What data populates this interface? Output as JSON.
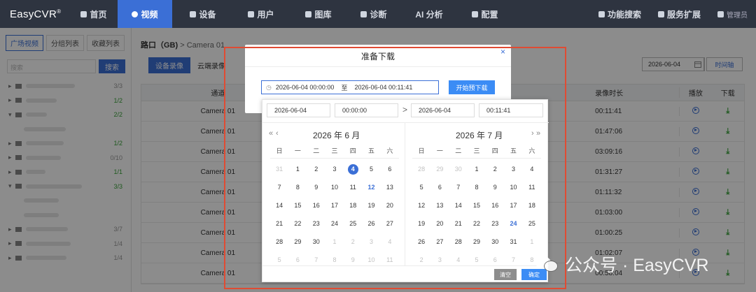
{
  "app": {
    "logo": "EasyCVR",
    "logo_mark": "®"
  },
  "nav": {
    "items": [
      {
        "label": "首页",
        "icon": "home-icon"
      },
      {
        "label": "视频",
        "icon": "video-play-icon",
        "active": true
      },
      {
        "label": "设备",
        "icon": "device-icon"
      },
      {
        "label": "用户",
        "icon": "user-icon"
      },
      {
        "label": "图库",
        "icon": "gallery-icon"
      },
      {
        "label": "诊断",
        "icon": "diagnosis-icon"
      },
      {
        "label": "AI 分析",
        "icon": ""
      },
      {
        "label": "配置",
        "icon": "gear-icon"
      }
    ],
    "right": [
      {
        "label": "功能搜索",
        "icon": "search-icon"
      },
      {
        "label": "服务扩展",
        "icon": "puzzle-icon"
      },
      {
        "label": "管理员",
        "icon": "user-icon"
      }
    ]
  },
  "sidebar": {
    "tabs": [
      "广场视频",
      "分组列表",
      "收藏列表"
    ],
    "search_placeholder": "搜索",
    "search_button": "搜索",
    "tree_counts": [
      "3/3",
      "1/2",
      "2/2",
      "",
      "1/2",
      "0/10",
      "1/1",
      "3/3",
      "",
      "",
      "3/7",
      "1/4",
      "1/4"
    ]
  },
  "content": {
    "breadcrumb_root": "路口（GB)",
    "breadcrumb_sep": ">",
    "breadcrumb_leaf": "Camera 01",
    "tabs": [
      "设备录像",
      "云端录像"
    ],
    "date": "2026-06-04",
    "timeline_button": "时间轴",
    "table": {
      "headers": {
        "channel": "通道",
        "duration": "录像时长",
        "play": "播放",
        "download": "下载"
      },
      "rows": [
        {
          "channel": "Camera 01",
          "duration": "00:11:41"
        },
        {
          "channel": "Camera 01",
          "duration": "01:47:06"
        },
        {
          "channel": "Camera 01",
          "duration": "03:09:16"
        },
        {
          "channel": "Camera 01",
          "duration": "01:31:27"
        },
        {
          "channel": "Camera 01",
          "duration": "01:11:32"
        },
        {
          "channel": "Camera 01",
          "duration": "01:03:00"
        },
        {
          "channel": "Camera 01",
          "duration": "01:00:25"
        },
        {
          "channel": "Camera 01",
          "duration": "01:02:07"
        },
        {
          "channel": "Camera 01",
          "duration": "00:58:04"
        }
      ]
    }
  },
  "dialog": {
    "title": "准备下载",
    "close": "×",
    "range_start": "2026-06-04 00:00:00",
    "range_sep": "至",
    "range_end": "2026-06-04 00:11:41",
    "prepare_button": "开始预下载"
  },
  "picker": {
    "start_date": "2026-06-04",
    "start_time": "00:00:00",
    "end_date": "2026-06-04",
    "end_time": "00:11:41",
    "left_title": "2026 年 6 月",
    "right_title": "2026 年 7 月",
    "prev_year": "«",
    "prev_month": "‹",
    "next_month": "›",
    "next_year": "»",
    "weekdays": [
      "日",
      "一",
      "二",
      "三",
      "四",
      "五",
      "六"
    ],
    "left_weeks": [
      [
        "31",
        "1",
        "2",
        "3",
        "4",
        "5",
        "6"
      ],
      [
        "7",
        "8",
        "9",
        "10",
        "11",
        "12",
        "13"
      ],
      [
        "14",
        "15",
        "16",
        "17",
        "18",
        "19",
        "20"
      ],
      [
        "21",
        "22",
        "23",
        "24",
        "25",
        "26",
        "27"
      ],
      [
        "28",
        "29",
        "30",
        "1",
        "2",
        "3",
        "4"
      ],
      [
        "5",
        "6",
        "7",
        "8",
        "9",
        "10",
        "11"
      ]
    ],
    "right_weeks": [
      [
        "28",
        "29",
        "30",
        "1",
        "2",
        "3",
        "4"
      ],
      [
        "5",
        "6",
        "7",
        "8",
        "9",
        "10",
        "11"
      ],
      [
        "12",
        "13",
        "14",
        "15",
        "16",
        "17",
        "18"
      ],
      [
        "19",
        "20",
        "21",
        "22",
        "23",
        "24",
        "25"
      ],
      [
        "26",
        "27",
        "28",
        "29",
        "30",
        "31",
        "1"
      ],
      [
        "2",
        "3",
        "4",
        "5",
        "6",
        "7",
        "8"
      ]
    ],
    "clear_button": "清空",
    "ok_button": "确定"
  },
  "watermark": {
    "text": "公众号 · EasyCVR"
  },
  "colors": {
    "accent": "#3b6fd6",
    "nav_bg": "#2e3440",
    "highlight": "#e04b33",
    "success": "#3aa33a"
  }
}
